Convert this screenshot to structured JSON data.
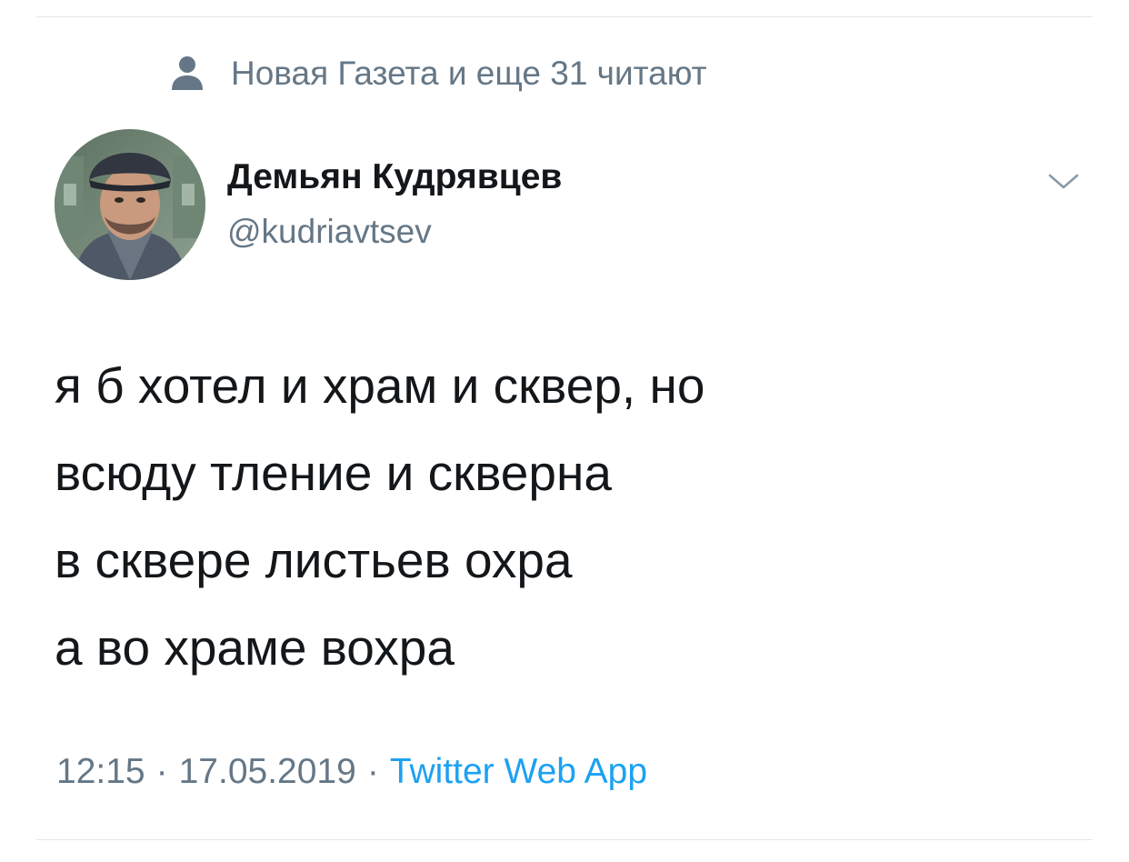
{
  "social_context": {
    "text": "Новая Газета и еще 31 читают",
    "icon": "person-icon"
  },
  "author": {
    "name": "Демьян Кудрявцев",
    "handle": "@kudriavtsev",
    "avatar_icon": "avatar-photo"
  },
  "tweet": {
    "lines": [
      "я б хотел и храм и сквер, но",
      "всюду тление и скверна",
      "в сквере листьев охра",
      "а во храме вохра"
    ]
  },
  "meta": {
    "time": "12:15",
    "separator": "·",
    "date": "17.05.2019",
    "source": "Twitter Web App"
  },
  "colors": {
    "text_primary": "#14171a",
    "text_secondary": "#657786",
    "link": "#1da1f2",
    "divider": "#e1e8ed"
  }
}
